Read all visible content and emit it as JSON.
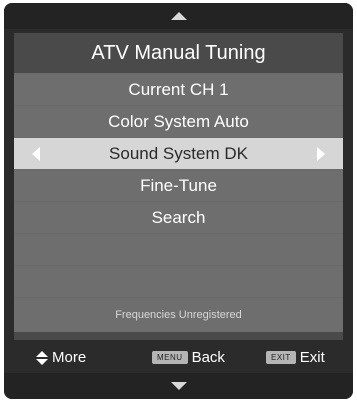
{
  "menu": {
    "title": "ATV Manual Tuning",
    "rows": [
      {
        "label": "Current CH 1"
      },
      {
        "label": "Color System Auto"
      },
      {
        "label": "Sound System DK"
      },
      {
        "label": "Fine-Tune"
      },
      {
        "label": "Search"
      },
      {
        "label": ""
      },
      {
        "label": ""
      },
      {
        "label": "Frequencies Unregistered"
      }
    ]
  },
  "hints": {
    "more_label": "More",
    "back_key": "MENU",
    "back_label": "Back",
    "exit_key": "EXIT",
    "exit_label": "Exit"
  },
  "icons": {
    "scroll_up": "triangle-up-icon",
    "scroll_down": "triangle-down-icon",
    "left": "arrow-left-icon",
    "right": "arrow-right-icon",
    "updown": "up-down-arrows-icon"
  },
  "colors": {
    "background": "#2b2b2b",
    "row": "#6e6e6e",
    "selected_row": "#d6d6d6",
    "text": "#ffffff"
  }
}
